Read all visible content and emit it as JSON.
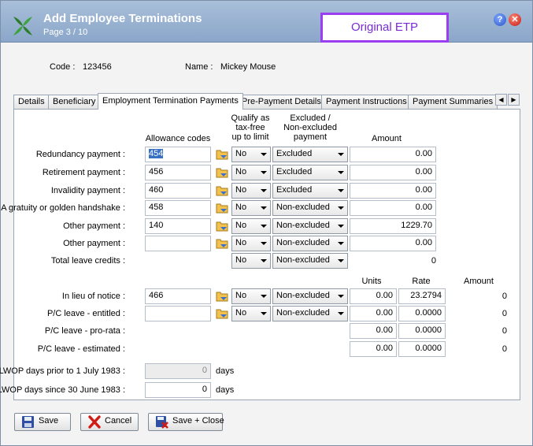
{
  "window": {
    "title": "Add Employee Terminations",
    "subtitle": "Page 3 / 10",
    "annotation": "Original ETP",
    "help_glyph": "?",
    "close_glyph": "✕"
  },
  "employee": {
    "code_label": "Code :",
    "code_value": "123456",
    "name_label": "Name :",
    "name_value": "Mickey Mouse"
  },
  "tabs": [
    {
      "label": "Details"
    },
    {
      "label": "Beneficiary"
    },
    {
      "label": "Employment Termination Payments"
    },
    {
      "label": "Pre-Payment Details"
    },
    {
      "label": "Payment Instructions"
    },
    {
      "label": "Payment Summaries"
    }
  ],
  "tab_scroll": {
    "left": "◀",
    "right": "▶"
  },
  "headers": {
    "allowance_codes": "Allowance codes",
    "qualify_l1": "Qualify as",
    "qualify_l2": "tax-free",
    "qualify_l3": "up to limit",
    "excluded_l1": "Excluded /",
    "excluded_l2": "Non-excluded",
    "excluded_l3": "payment",
    "amount": "Amount",
    "units": "Units",
    "rate": "Rate",
    "amount2": "Amount"
  },
  "payments": [
    {
      "label": "Redundancy payment :",
      "code": "454",
      "qualify": "No",
      "excluded": "Excluded",
      "amount": "0.00"
    },
    {
      "label": "Retirement payment :",
      "code": "456",
      "qualify": "No",
      "excluded": "Excluded",
      "amount": "0.00"
    },
    {
      "label": "Invalidity payment :",
      "code": "460",
      "qualify": "No",
      "excluded": "Excluded",
      "amount": "0.00"
    },
    {
      "label": "A gratuity or golden handshake :",
      "code": "458",
      "qualify": "No",
      "excluded": "Non-excluded",
      "amount": "0.00"
    },
    {
      "label": "Other payment :",
      "code": "140",
      "qualify": "No",
      "excluded": "Non-excluded",
      "amount": "1229.70"
    },
    {
      "label": "Other payment :",
      "code": "",
      "qualify": "No",
      "excluded": "Non-excluded",
      "amount": "0.00"
    }
  ],
  "total_leave": {
    "label": "Total leave credits :",
    "qualify": "No",
    "excluded": "Non-excluded",
    "amount": "0"
  },
  "leave_rows": [
    {
      "label": "In lieu of notice :",
      "code": "466",
      "qualify": "No",
      "excluded": "Non-excluded",
      "units": "0.00",
      "rate": "23.2794",
      "amount": "0"
    },
    {
      "label": "P/C leave - entitled :",
      "code": "",
      "qualify": "No",
      "excluded": "Non-excluded",
      "units": "0.00",
      "rate": "0.0000",
      "amount": "0"
    },
    {
      "label": "P/C leave - pro-rata :",
      "units": "0.00",
      "rate": "0.0000",
      "amount": "0"
    },
    {
      "label": "P/C leave - estimated :",
      "units": "0.00",
      "rate": "0.0000",
      "amount": "0"
    }
  ],
  "lwop": [
    {
      "label": "LWOP days prior to 1 July 1983 :",
      "value": "0",
      "unit": "days"
    },
    {
      "label": "LWOP days since 30 June 1983 :",
      "value": "0",
      "unit": "days"
    }
  ],
  "buttons": {
    "save": "Save",
    "cancel": "Cancel",
    "save_close": "Save + Close"
  },
  "colors": {
    "title_bar": "#8aa6c9",
    "annotation_border": "#9b3df0",
    "annotation_text": "#7a2bd8"
  }
}
